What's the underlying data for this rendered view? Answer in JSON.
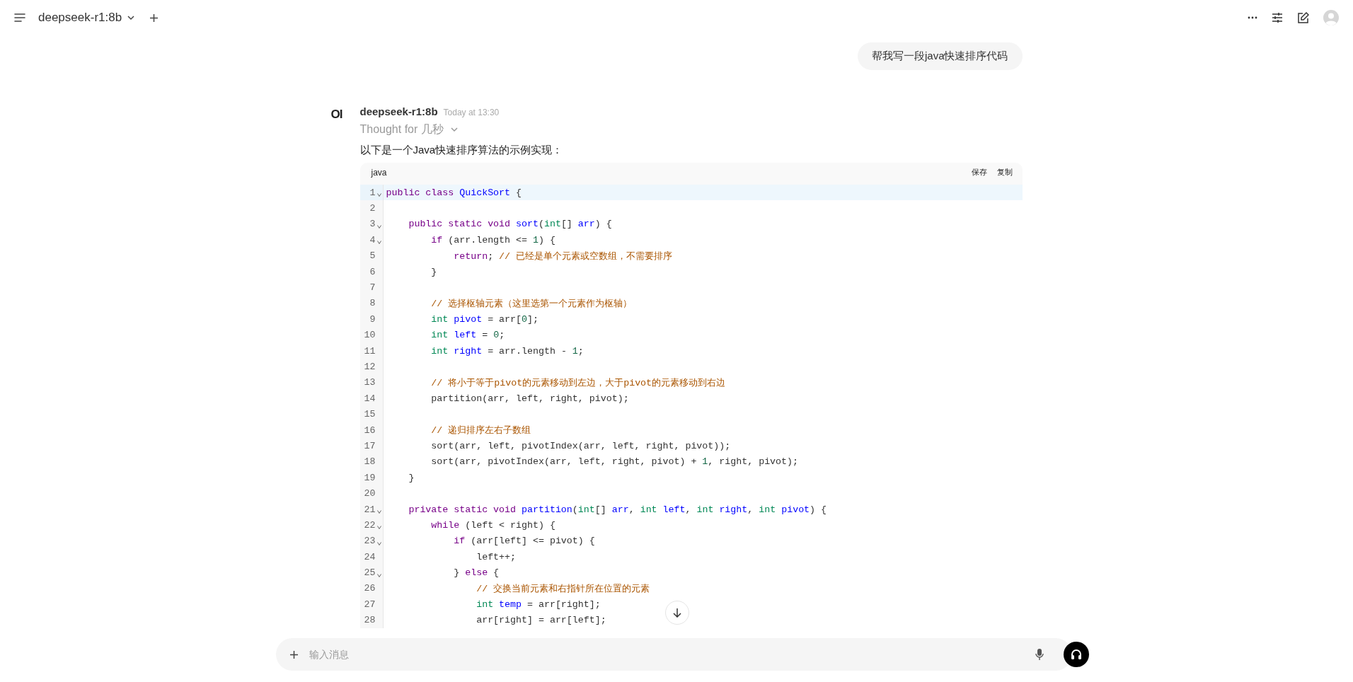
{
  "header": {
    "model": "deepseek-r1:8b"
  },
  "user_message": {
    "text": "帮我写一段java快速排序代码"
  },
  "assistant": {
    "logo_text": "OI",
    "name": "deepseek-r1:8b",
    "time": "Today at 13:30",
    "thought": "Thought for 几秒",
    "intro": "以下是一个Java快速排序算法的示例实现：",
    "code": {
      "language": "java",
      "actions": [
        "保存",
        "复制"
      ],
      "lines": [
        {
          "n": "1",
          "fold": true,
          "highlighted": true,
          "tokens": [
            {
              "kind": "kw",
              "t": "public class "
            },
            {
              "kind": "def",
              "t": "QuickSort"
            },
            {
              "kind": "p",
              "t": " {"
            }
          ]
        },
        {
          "n": "2",
          "fold": false,
          "highlighted": false
        },
        {
          "n": "3",
          "fold": true,
          "highlighted": false,
          "tokens": [
            {
              "kind": "kw",
              "t": "    public static void "
            },
            {
              "kind": "def",
              "t": "sort"
            },
            {
              "kind": "p",
              "t": "("
            },
            {
              "kind": "type",
              "t": "int"
            },
            {
              "kind": "p",
              "t": "[] "
            },
            {
              "kind": "def",
              "t": "arr"
            },
            {
              "kind": "p",
              "t": ") {"
            }
          ]
        },
        {
          "n": "4",
          "fold": true,
          "highlighted": false,
          "tokens": [
            {
              "kind": "kw",
              "t": "        if"
            },
            {
              "kind": "p",
              "t": " (arr.length <= "
            },
            {
              "kind": "num",
              "t": "1"
            },
            {
              "kind": "p",
              "t": ") {"
            }
          ]
        },
        {
          "n": "5",
          "fold": false,
          "highlighted": false,
          "tokens": [
            {
              "kind": "kw",
              "t": "            return"
            },
            {
              "kind": "p",
              "t": "; "
            },
            {
              "kind": "com",
              "t": "// 已经是单个元素或空数组，不需要排序"
            }
          ]
        },
        {
          "n": "6",
          "fold": false,
          "highlighted": false,
          "tokens": [
            {
              "kind": "p",
              "t": "        }"
            }
          ]
        },
        {
          "n": "7",
          "fold": false,
          "highlighted": false
        },
        {
          "n": "8",
          "fold": false,
          "highlighted": false,
          "tokens": [
            {
              "kind": "com",
              "t": "        // 选择枢轴元素（这里选第一个元素作为枢轴）"
            }
          ]
        },
        {
          "n": "9",
          "fold": false,
          "highlighted": false,
          "tokens": [
            {
              "kind": "type",
              "t": "        int "
            },
            {
              "kind": "def",
              "t": "pivot"
            },
            {
              "kind": "p",
              "t": " = arr["
            },
            {
              "kind": "num",
              "t": "0"
            },
            {
              "kind": "p",
              "t": "];"
            }
          ]
        },
        {
          "n": "10",
          "fold": false,
          "highlighted": false,
          "tokens": [
            {
              "kind": "type",
              "t": "        int "
            },
            {
              "kind": "def",
              "t": "left"
            },
            {
              "kind": "p",
              "t": " = "
            },
            {
              "kind": "num",
              "t": "0"
            },
            {
              "kind": "p",
              "t": ";"
            }
          ]
        },
        {
          "n": "11",
          "fold": false,
          "highlighted": false,
          "tokens": [
            {
              "kind": "type",
              "t": "        int "
            },
            {
              "kind": "def",
              "t": "right"
            },
            {
              "kind": "p",
              "t": " = arr.length - "
            },
            {
              "kind": "num",
              "t": "1"
            },
            {
              "kind": "p",
              "t": ";"
            }
          ]
        },
        {
          "n": "12",
          "fold": false,
          "highlighted": false
        },
        {
          "n": "13",
          "fold": false,
          "highlighted": false,
          "tokens": [
            {
              "kind": "com",
              "t": "        // 将小于等于pivot的元素移动到左边，大于pivot的元素移动到右边"
            }
          ]
        },
        {
          "n": "14",
          "fold": false,
          "highlighted": false,
          "tokens": [
            {
              "kind": "p",
              "t": "        partition(arr, left, right, pivot);"
            }
          ]
        },
        {
          "n": "15",
          "fold": false,
          "highlighted": false
        },
        {
          "n": "16",
          "fold": false,
          "highlighted": false,
          "tokens": [
            {
              "kind": "com",
              "t": "        // 递归排序左右子数组"
            }
          ]
        },
        {
          "n": "17",
          "fold": false,
          "highlighted": false,
          "tokens": [
            {
              "kind": "p",
              "t": "        sort(arr, left, pivotIndex(arr, left, right, pivot));"
            }
          ]
        },
        {
          "n": "18",
          "fold": false,
          "highlighted": false,
          "tokens": [
            {
              "kind": "p",
              "t": "        sort(arr, pivotIndex(arr, left, right, pivot) + "
            },
            {
              "kind": "num",
              "t": "1"
            },
            {
              "kind": "p",
              "t": ", right, pivot);"
            }
          ]
        },
        {
          "n": "19",
          "fold": false,
          "highlighted": false,
          "tokens": [
            {
              "kind": "p",
              "t": "    }"
            }
          ]
        },
        {
          "n": "20",
          "fold": false,
          "highlighted": false
        },
        {
          "n": "21",
          "fold": true,
          "highlighted": false,
          "tokens": [
            {
              "kind": "kw",
              "t": "    private static void "
            },
            {
              "kind": "def",
              "t": "partition"
            },
            {
              "kind": "p",
              "t": "("
            },
            {
              "kind": "type",
              "t": "int"
            },
            {
              "kind": "p",
              "t": "[] "
            },
            {
              "kind": "def",
              "t": "arr"
            },
            {
              "kind": "p",
              "t": ", "
            },
            {
              "kind": "type",
              "t": "int "
            },
            {
              "kind": "def",
              "t": "left"
            },
            {
              "kind": "p",
              "t": ", "
            },
            {
              "kind": "type",
              "t": "int "
            },
            {
              "kind": "def",
              "t": "right"
            },
            {
              "kind": "p",
              "t": ", "
            },
            {
              "kind": "type",
              "t": "int "
            },
            {
              "kind": "def",
              "t": "pivot"
            },
            {
              "kind": "p",
              "t": ") {"
            }
          ]
        },
        {
          "n": "22",
          "fold": true,
          "highlighted": false,
          "tokens": [
            {
              "kind": "kw",
              "t": "        while"
            },
            {
              "kind": "p",
              "t": " (left < right) {"
            }
          ]
        },
        {
          "n": "23",
          "fold": true,
          "highlighted": false,
          "tokens": [
            {
              "kind": "kw",
              "t": "            if"
            },
            {
              "kind": "p",
              "t": " (arr[left] <= pivot) {"
            }
          ]
        },
        {
          "n": "24",
          "fold": false,
          "highlighted": false,
          "tokens": [
            {
              "kind": "p",
              "t": "                left++;"
            }
          ]
        },
        {
          "n": "25",
          "fold": true,
          "highlighted": false,
          "tokens": [
            {
              "kind": "p",
              "t": "            } "
            },
            {
              "kind": "kw",
              "t": "else"
            },
            {
              "kind": "p",
              "t": " {"
            }
          ]
        },
        {
          "n": "26",
          "fold": false,
          "highlighted": false,
          "tokens": [
            {
              "kind": "com",
              "t": "                // 交换当前元素和右指针所在位置的元素"
            }
          ]
        },
        {
          "n": "27",
          "fold": false,
          "highlighted": false,
          "tokens": [
            {
              "kind": "type",
              "t": "                int "
            },
            {
              "kind": "def",
              "t": "temp"
            },
            {
              "kind": "p",
              "t": " = arr[right];"
            }
          ]
        },
        {
          "n": "28",
          "fold": false,
          "highlighted": false,
          "tokens": [
            {
              "kind": "p",
              "t": "                arr[right] = arr[left];"
            }
          ]
        }
      ]
    }
  },
  "input": {
    "placeholder": "输入消息"
  }
}
